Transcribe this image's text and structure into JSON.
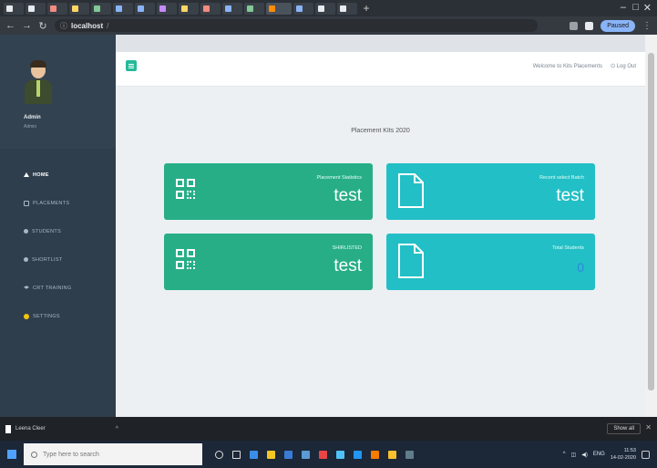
{
  "browser": {
    "tabs": [
      {
        "color": "#e8eaed"
      },
      {
        "color": "#e8eaed"
      },
      {
        "color": "#f28b82"
      },
      {
        "color": "#fdd663"
      },
      {
        "color": "#81c995"
      },
      {
        "color": "#8ab4f8"
      },
      {
        "color": "#8ab4f8"
      },
      {
        "color": "#c58af9"
      },
      {
        "color": "#fdd663"
      },
      {
        "color": "#f28b82"
      },
      {
        "color": "#8ab4f8"
      },
      {
        "color": "#81c995"
      },
      {
        "color": "#ff8c00",
        "active": true
      },
      {
        "color": "#8ab4f8"
      },
      {
        "color": "#e8eaed"
      },
      {
        "color": "#e8eaed"
      }
    ],
    "new_tab": "+",
    "url_host": "localhost",
    "url_path": "/",
    "profile_label": "Paused"
  },
  "sidebar": {
    "user_name": "Admin",
    "user_role": "Admin",
    "items": [
      {
        "label": "HOME",
        "icon": "home-icon",
        "active": true
      },
      {
        "label": "PLACEMENTS",
        "icon": "placements-icon"
      },
      {
        "label": "STUDENTS",
        "icon": "students-icon"
      },
      {
        "label": "SHORTLIST",
        "icon": "shortlist-icon"
      },
      {
        "label": "CRT TRAINING",
        "icon": "training-icon"
      },
      {
        "label": "SETTINGS",
        "icon": "settings-gear-icon"
      }
    ]
  },
  "topbar": {
    "welcome": "Welcome to Kits Placements",
    "logout": "Log Out"
  },
  "main": {
    "title": "Placement KIts 2020",
    "cards": [
      {
        "label": "Placement Statistics",
        "value": "test",
        "icon": "qr-code-icon",
        "color": "#27ae87"
      },
      {
        "label": "Recent select Batch",
        "value": "test",
        "icon": "document-icon",
        "color": "#22bfc6"
      },
      {
        "label": "SHIRLISTED",
        "value": "test",
        "icon": "qr-code-icon",
        "color": "#27ae87"
      },
      {
        "label": "Total Students",
        "value": "0",
        "icon": "document-icon",
        "color": "#22bfc6"
      }
    ]
  },
  "downloads": {
    "file_name": "Leena Cleer",
    "show_all": "Show all"
  },
  "taskbar": {
    "search_placeholder": "Type here to search",
    "time": "11:53",
    "date": "14-02-2020",
    "lang": "ENG"
  }
}
